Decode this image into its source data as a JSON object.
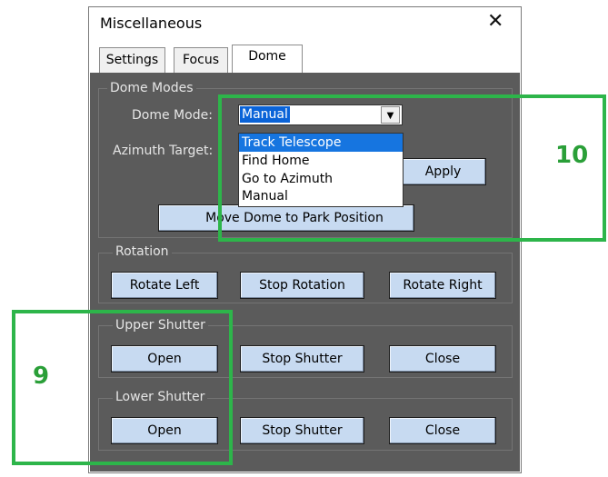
{
  "window": {
    "title": "Miscellaneous"
  },
  "tabs": [
    {
      "label": "Settings",
      "active": false
    },
    {
      "label": "Focus",
      "active": false
    },
    {
      "label": "Dome",
      "active": true
    }
  ],
  "dome_modes": {
    "group_label": "Dome Modes",
    "mode_label": "Dome Mode:",
    "mode_value": "Manual",
    "options": [
      "Track Telescope",
      "Find Home",
      "Go to Azimuth",
      "Manual"
    ],
    "highlighted_option": "Track Telescope",
    "azimuth_label": "Azimuth Target:",
    "apply_label": "Apply",
    "park_label": "Move Dome to Park Position"
  },
  "rotation": {
    "group_label": "Rotation",
    "left_label": "Rotate Left",
    "stop_label": "Stop Rotation",
    "right_label": "Rotate Right"
  },
  "upper_shutter": {
    "group_label": "Upper Shutter",
    "open_label": "Open",
    "stop_label": "Stop Shutter",
    "close_label": "Close"
  },
  "lower_shutter": {
    "group_label": "Lower Shutter",
    "open_label": "Open",
    "stop_label": "Stop Shutter",
    "close_label": "Close"
  },
  "annotations": {
    "box1": "10",
    "box2": "9",
    "color": "#2db54a"
  },
  "colors": {
    "panel": "#5b5b5b",
    "button": "#c7daf1",
    "selection": "#1675e0"
  }
}
